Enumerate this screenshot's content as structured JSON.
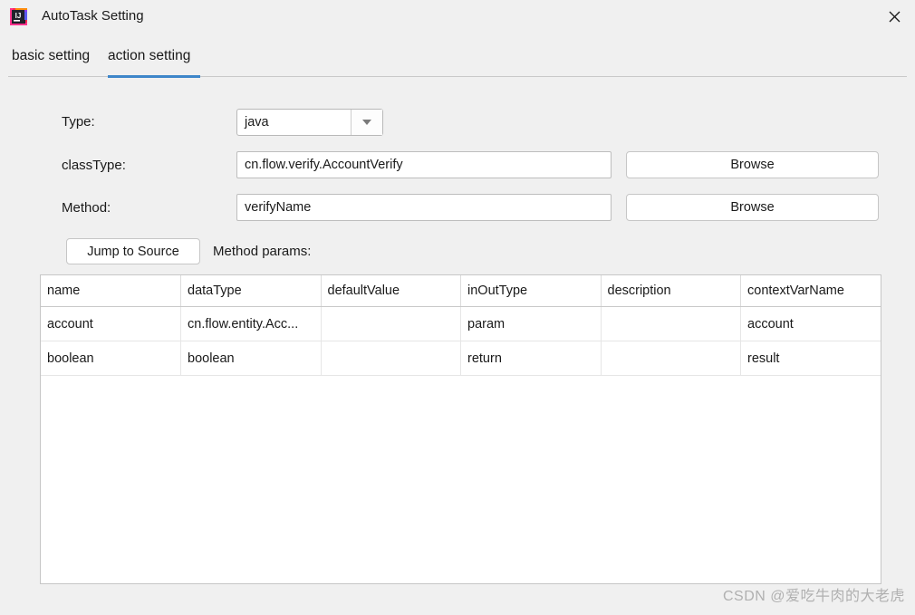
{
  "window": {
    "title": "AutoTask Setting",
    "icon": "intellij-idea-icon",
    "close_label": "✕"
  },
  "tabs": [
    {
      "id": "basic",
      "label": "basic setting",
      "active": false
    },
    {
      "id": "action",
      "label": "action setting",
      "active": true
    }
  ],
  "accent_color": "#3e86c9",
  "form": {
    "type": {
      "label": "Type:",
      "value": "java",
      "options": [
        "java"
      ]
    },
    "classType": {
      "label": "classType:",
      "value": "cn.flow.verify.AccountVerify",
      "placeholder": "",
      "browse_label": "Browse"
    },
    "method": {
      "label": "Method:",
      "value": "verifyName",
      "placeholder": "",
      "browse_label": "Browse"
    },
    "jump_to_source_label": "Jump to Source",
    "method_params_label": "Method params:"
  },
  "table": {
    "columns": [
      "name",
      "dataType",
      "defaultValue",
      "inOutType",
      "description",
      "contextVarName"
    ],
    "rows": [
      {
        "name": "account",
        "dataType": "cn.flow.entity.Acc...",
        "defaultValue": "",
        "inOutType": "param",
        "description": "",
        "contextVarName": "account"
      },
      {
        "name": "boolean",
        "dataType": "boolean",
        "defaultValue": "",
        "inOutType": "return",
        "description": "",
        "contextVarName": "result"
      }
    ]
  },
  "watermark": "CSDN @爱吃牛肉的大老虎"
}
